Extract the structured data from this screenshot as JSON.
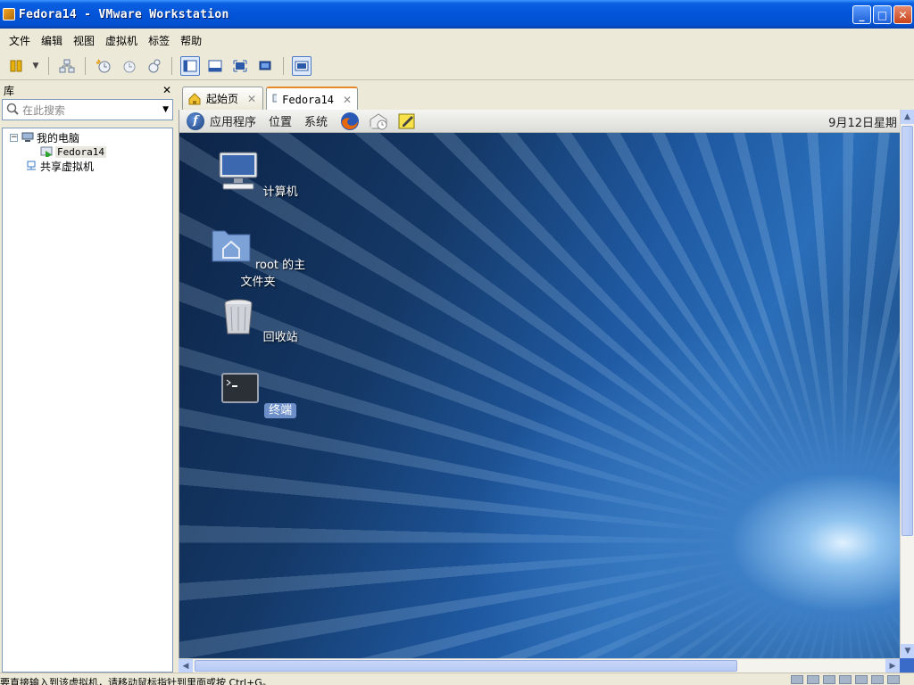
{
  "window": {
    "title": "Fedora14 - VMware Workstation",
    "minimize": "_",
    "maximize": "□",
    "close": "✕"
  },
  "menu": [
    "文件",
    "编辑",
    "视图",
    "虚拟机",
    "标签",
    "帮助"
  ],
  "library": {
    "title": "库",
    "close": "✕",
    "search_placeholder": "在此搜索",
    "tree": {
      "my_computer": "我的电脑",
      "vm": "Fedora14",
      "shared": "共享虚拟机",
      "expander": "−"
    }
  },
  "tabs": [
    {
      "label": "起始页",
      "close": "✕"
    },
    {
      "label": "Fedora14",
      "close": "✕"
    }
  ],
  "guest": {
    "panel": {
      "logo": "f",
      "apps": "应用程序",
      "places": "位置",
      "system": "系统",
      "clock": "9月12日星期"
    },
    "desktop_icons": [
      {
        "label": "计算机"
      },
      {
        "label": "root 的主文件夹"
      },
      {
        "label": "回收站"
      },
      {
        "label": "终端"
      }
    ]
  },
  "statusbar": {
    "message": "要直接输入到该虚拟机，请移动鼠标指针到里面或按 Ctrl+G。"
  },
  "colors": {
    "titlebar": "#0354d8",
    "chrome": "#ece9d8",
    "tab_accent": "#e68b2c"
  }
}
